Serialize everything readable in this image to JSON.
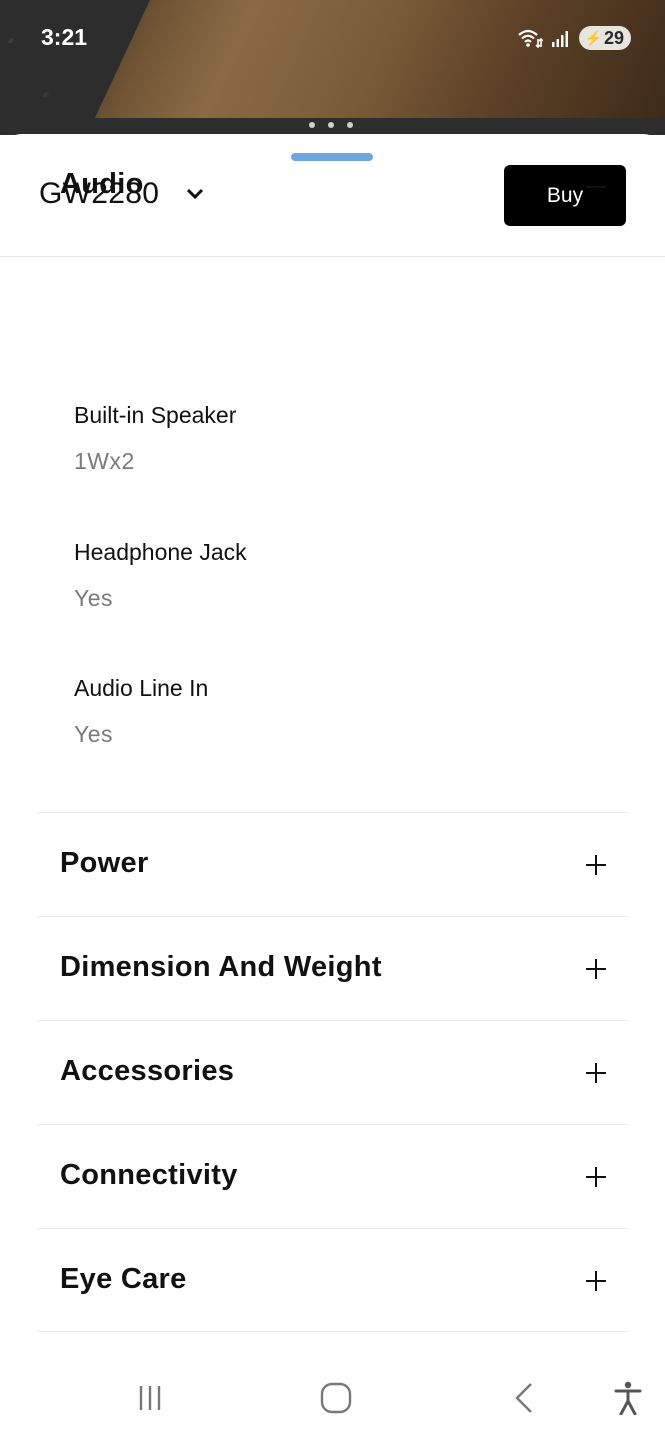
{
  "status_bar": {
    "time": "3:21",
    "battery": "29",
    "icons": [
      "wifi-icon",
      "signal-icon",
      "battery-icon"
    ]
  },
  "header": {
    "model": "GW2280",
    "buy_label": "Buy"
  },
  "audio": {
    "title": "Audio",
    "expanded": true,
    "specs": [
      {
        "label": "Built-in Speaker",
        "value": "1Wx2"
      },
      {
        "label": "Headphone Jack",
        "value": "Yes"
      },
      {
        "label": "Audio Line In",
        "value": "Yes"
      }
    ]
  },
  "sections": [
    {
      "title": "Power"
    },
    {
      "title": "Dimension And Weight"
    },
    {
      "title": "Accessories"
    },
    {
      "title": "Connectivity"
    },
    {
      "title": "Eye Care"
    }
  ],
  "nav": [
    "recent-apps-icon",
    "home-icon",
    "back-icon",
    "accessibility-icon"
  ],
  "colors": {
    "handle": "#6fa6e0",
    "buy_bg": "#000000",
    "value_text": "#7a7a7a"
  }
}
